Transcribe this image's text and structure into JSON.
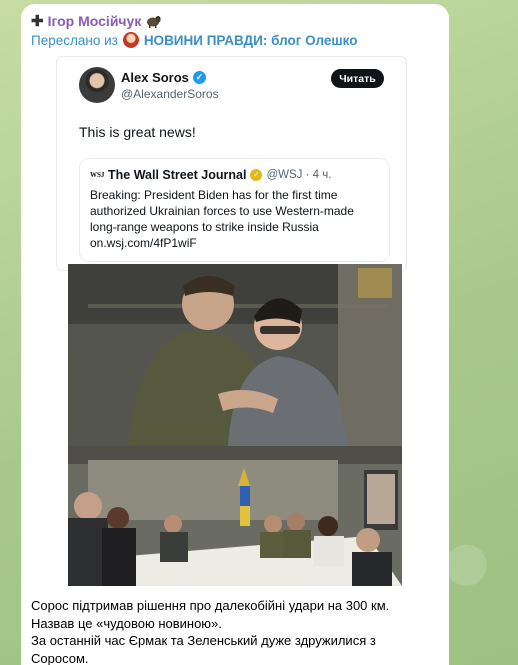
{
  "message": {
    "sender_name": "Ігор Мосійчук",
    "sender_prefix_icon": "plus-icon",
    "sender_suffix_icon": "ram-emoji",
    "forwarded_prefix": "Переслано из",
    "forwarded_channel": "НОВИНИ ПРАВДИ: блог Олешко"
  },
  "tweet": {
    "author_name": "Alex Soros",
    "author_handle": "@AlexanderSoros",
    "read_button": "Читать",
    "text": "This is great news!",
    "quote": {
      "source_name": "The Wall Street Journal",
      "source_meta": "@WSJ · 4 ч.",
      "body": "Breaking: President Biden has for the first time authorized Ukrainian forces to use Western-made long-range weapons to strike inside Russia on.wsj.com/4fP1wiF"
    }
  },
  "caption": {
    "line1": "Сорос підтримав рішення про далекобійні удари на 300 км.",
    "line2": "Назвав це «чудовою новиною».",
    "line3": "За останній час Єрмак та Зеленський дуже здружилися з Соросом."
  },
  "colors": {
    "sender": "#8b5ab8",
    "forwarded": "#3a8fc4",
    "twitter_blue": "#1d9bf0",
    "wsj_gold": "#e2b719",
    "wallpaper": "#b9d39a"
  }
}
